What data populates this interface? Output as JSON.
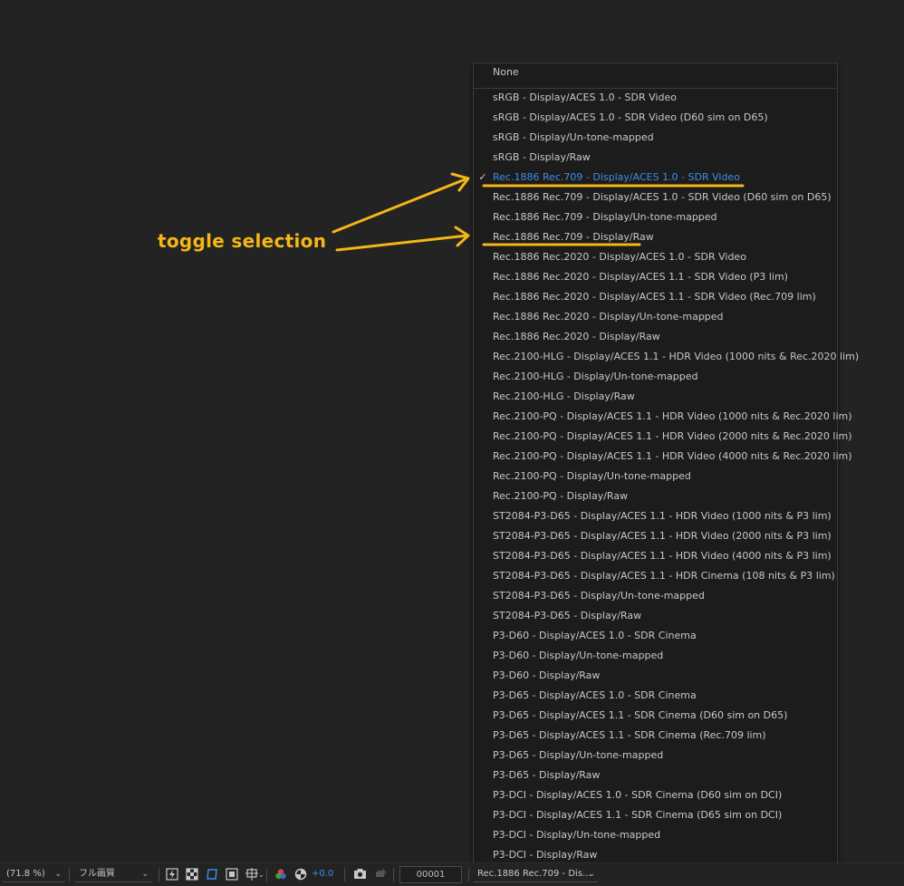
{
  "menu": {
    "none_label": "None",
    "items": [
      {
        "label": "sRGB - Display/ACES 1.0 - SDR Video",
        "checked": false
      },
      {
        "label": "sRGB - Display/ACES 1.0 - SDR Video (D60 sim on D65)",
        "checked": false
      },
      {
        "label": "sRGB - Display/Un-tone-mapped",
        "checked": false
      },
      {
        "label": "sRGB - Display/Raw",
        "checked": false
      },
      {
        "label": "Rec.1886 Rec.709 - Display/ACES 1.0 - SDR Video",
        "checked": true
      },
      {
        "label": "Rec.1886 Rec.709 - Display/ACES 1.0 - SDR Video (D60 sim on D65)",
        "checked": false
      },
      {
        "label": "Rec.1886 Rec.709 - Display/Un-tone-mapped",
        "checked": false
      },
      {
        "label": "Rec.1886 Rec.709 - Display/Raw",
        "checked": false
      },
      {
        "label": "Rec.1886 Rec.2020 - Display/ACES 1.0 - SDR Video",
        "checked": false
      },
      {
        "label": "Rec.1886 Rec.2020 - Display/ACES 1.1 - SDR Video (P3 lim)",
        "checked": false
      },
      {
        "label": "Rec.1886 Rec.2020 - Display/ACES 1.1 - SDR Video (Rec.709 lim)",
        "checked": false
      },
      {
        "label": "Rec.1886 Rec.2020 - Display/Un-tone-mapped",
        "checked": false
      },
      {
        "label": "Rec.1886 Rec.2020 - Display/Raw",
        "checked": false
      },
      {
        "label": "Rec.2100-HLG - Display/ACES 1.1 - HDR Video (1000 nits & Rec.2020 lim)",
        "checked": false
      },
      {
        "label": "Rec.2100-HLG - Display/Un-tone-mapped",
        "checked": false
      },
      {
        "label": "Rec.2100-HLG - Display/Raw",
        "checked": false
      },
      {
        "label": "Rec.2100-PQ - Display/ACES 1.1 - HDR Video (1000 nits & Rec.2020 lim)",
        "checked": false
      },
      {
        "label": "Rec.2100-PQ - Display/ACES 1.1 - HDR Video (2000 nits & Rec.2020 lim)",
        "checked": false
      },
      {
        "label": "Rec.2100-PQ - Display/ACES 1.1 - HDR Video (4000 nits & Rec.2020 lim)",
        "checked": false
      },
      {
        "label": "Rec.2100-PQ - Display/Un-tone-mapped",
        "checked": false
      },
      {
        "label": "Rec.2100-PQ - Display/Raw",
        "checked": false
      },
      {
        "label": "ST2084-P3-D65 - Display/ACES 1.1 - HDR Video (1000 nits & P3 lim)",
        "checked": false
      },
      {
        "label": "ST2084-P3-D65 - Display/ACES 1.1 - HDR Video (2000 nits & P3 lim)",
        "checked": false
      },
      {
        "label": "ST2084-P3-D65 - Display/ACES 1.1 - HDR Video (4000 nits & P3 lim)",
        "checked": false
      },
      {
        "label": "ST2084-P3-D65 - Display/ACES 1.1 - HDR Cinema (108 nits & P3 lim)",
        "checked": false
      },
      {
        "label": "ST2084-P3-D65 - Display/Un-tone-mapped",
        "checked": false
      },
      {
        "label": "ST2084-P3-D65 - Display/Raw",
        "checked": false
      },
      {
        "label": "P3-D60 - Display/ACES 1.0 - SDR Cinema",
        "checked": false
      },
      {
        "label": "P3-D60 - Display/Un-tone-mapped",
        "checked": false
      },
      {
        "label": "P3-D60 - Display/Raw",
        "checked": false
      },
      {
        "label": "P3-D65 - Display/ACES 1.0 - SDR Cinema",
        "checked": false
      },
      {
        "label": "P3-D65 - Display/ACES 1.1 - SDR Cinema (D60 sim on D65)",
        "checked": false
      },
      {
        "label": "P3-D65 - Display/ACES 1.1 - SDR Cinema (Rec.709 lim)",
        "checked": false
      },
      {
        "label": "P3-D65 - Display/Un-tone-mapped",
        "checked": false
      },
      {
        "label": "P3-D65 - Display/Raw",
        "checked": false
      },
      {
        "label": "P3-DCI - Display/ACES 1.0 - SDR Cinema (D60 sim on DCI)",
        "checked": false
      },
      {
        "label": "P3-DCI - Display/ACES 1.1 - SDR Cinema (D65 sim on DCI)",
        "checked": false
      },
      {
        "label": "P3-DCI - Display/Un-tone-mapped",
        "checked": false
      },
      {
        "label": "P3-DCI - Display/Raw",
        "checked": false
      }
    ]
  },
  "annotation": {
    "text": "toggle selection",
    "color": "#f5b617"
  },
  "toolbar": {
    "zoom": "(71.8 %)",
    "resolution": "フル画質",
    "exposure": "+0.0",
    "timecode": "00001",
    "display_transform": "Rec.1886 Rec.709 - Dis...",
    "icons": [
      "fast-preview-icon",
      "transparency-grid-icon",
      "mask-outline-icon",
      "region-of-interest-icon",
      "guides-grid-icon",
      "color-channels-icon",
      "reset-exposure-icon",
      "snapshot-camera-icon",
      "show-snapshot-icon"
    ]
  },
  "colors": {
    "background": "#232323",
    "menu_bg": "#1c1c1c",
    "text": "#c8c8c8",
    "accent": "#3d8ee8"
  }
}
